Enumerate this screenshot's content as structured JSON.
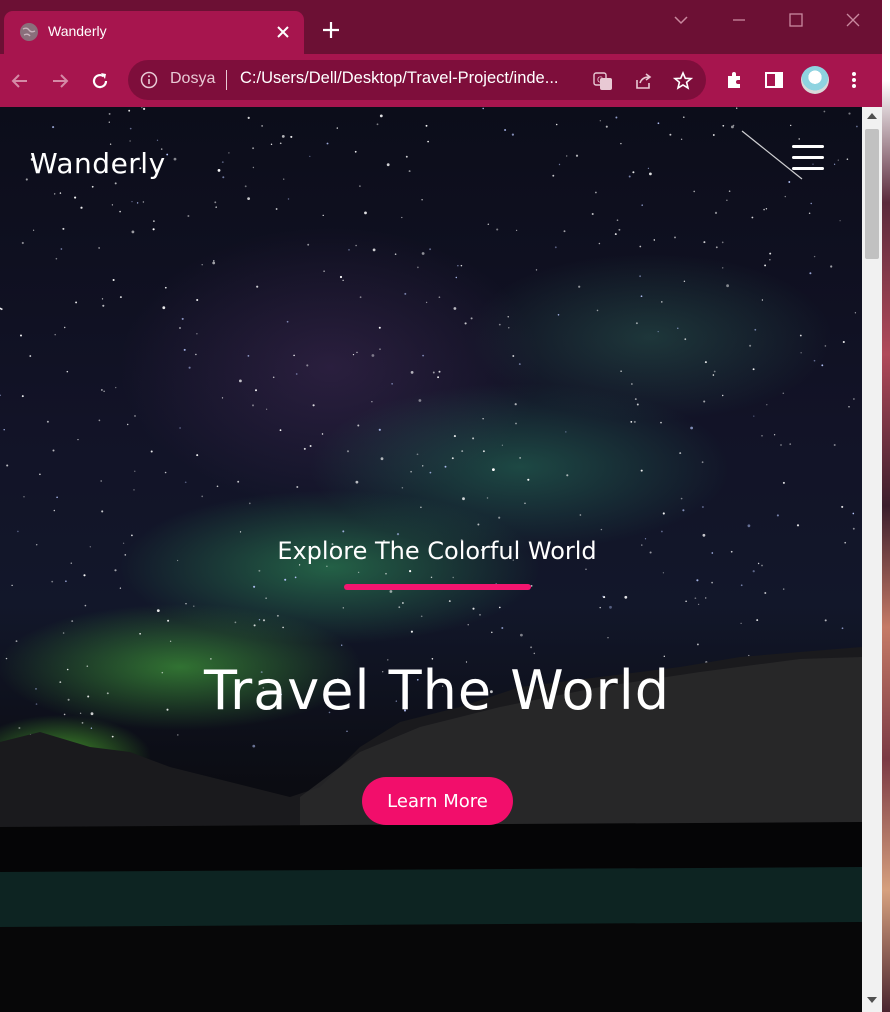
{
  "browser": {
    "tab": {
      "title": "Wanderly"
    },
    "address_bar": {
      "site_info_label": "Dosya",
      "url": "C:/Users/Dell/Desktop/Travel-Project/inde..."
    }
  },
  "page": {
    "logo": "Wanderly",
    "hero": {
      "subtitle": "Explore The Colorful World",
      "title": "Travel The World",
      "cta_label": "Learn More"
    }
  },
  "colors": {
    "titlebar": "#6c1034",
    "toolbar": "#a7154e",
    "accent": "#f20e6b"
  },
  "icons": [
    "globe-icon",
    "close-icon",
    "plus-icon",
    "chevron-down-icon",
    "minimize-icon",
    "maximize-icon",
    "back-icon",
    "forward-icon",
    "reload-icon",
    "info-icon",
    "translate-icon",
    "share-icon",
    "star-icon",
    "extensions-icon",
    "sidepanel-icon",
    "more-icon",
    "hamburger-icon"
  ]
}
